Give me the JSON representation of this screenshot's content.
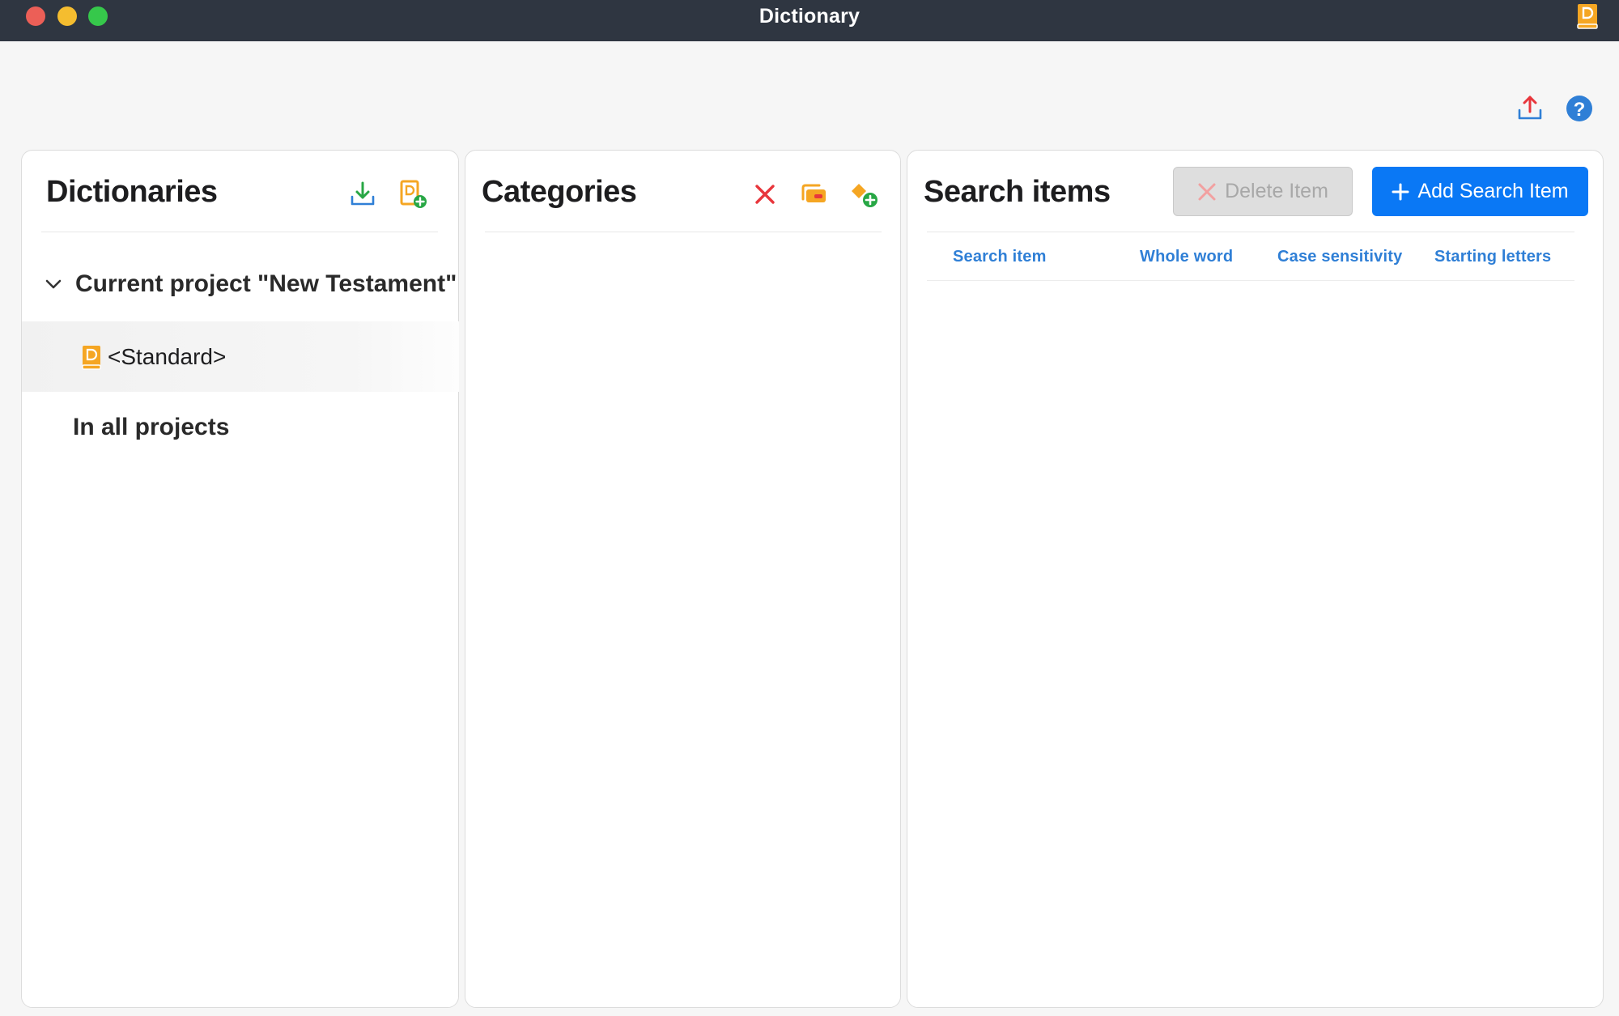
{
  "window": {
    "title": "Dictionary",
    "traffic_lights": [
      "close",
      "minimize",
      "maximize"
    ]
  },
  "toolbar": {
    "icons": [
      "export-icon",
      "help-icon"
    ],
    "help_glyph": "?"
  },
  "dictionaries": {
    "title": "Dictionaries",
    "actions": [
      "import-icon",
      "new-dictionary-icon"
    ],
    "current_project": {
      "label": "Current project \"New Testament\"",
      "expanded": true,
      "items": [
        {
          "label": "<Standard>",
          "icon": "dictionary-book-icon",
          "selected": true
        }
      ]
    },
    "all_projects": {
      "label": "In all projects"
    }
  },
  "categories": {
    "title": "Categories",
    "actions": [
      "delete-category-icon",
      "rename-category-icon",
      "add-category-icon"
    ]
  },
  "search_items": {
    "title": "Search items",
    "delete_label": "Delete Item",
    "delete_enabled": false,
    "add_label": "Add Search Item",
    "columns": [
      "Search item",
      "Whole word",
      "Case sensitivity",
      "Starting letters"
    ],
    "rows": []
  },
  "colors": {
    "titlebar": "#2f3641",
    "accent_blue": "#0a78f5",
    "column_header": "#2f7fd6",
    "delete_red": "#e8363c",
    "dictionary_orange": "#f5a623",
    "add_green": "#28a745"
  }
}
